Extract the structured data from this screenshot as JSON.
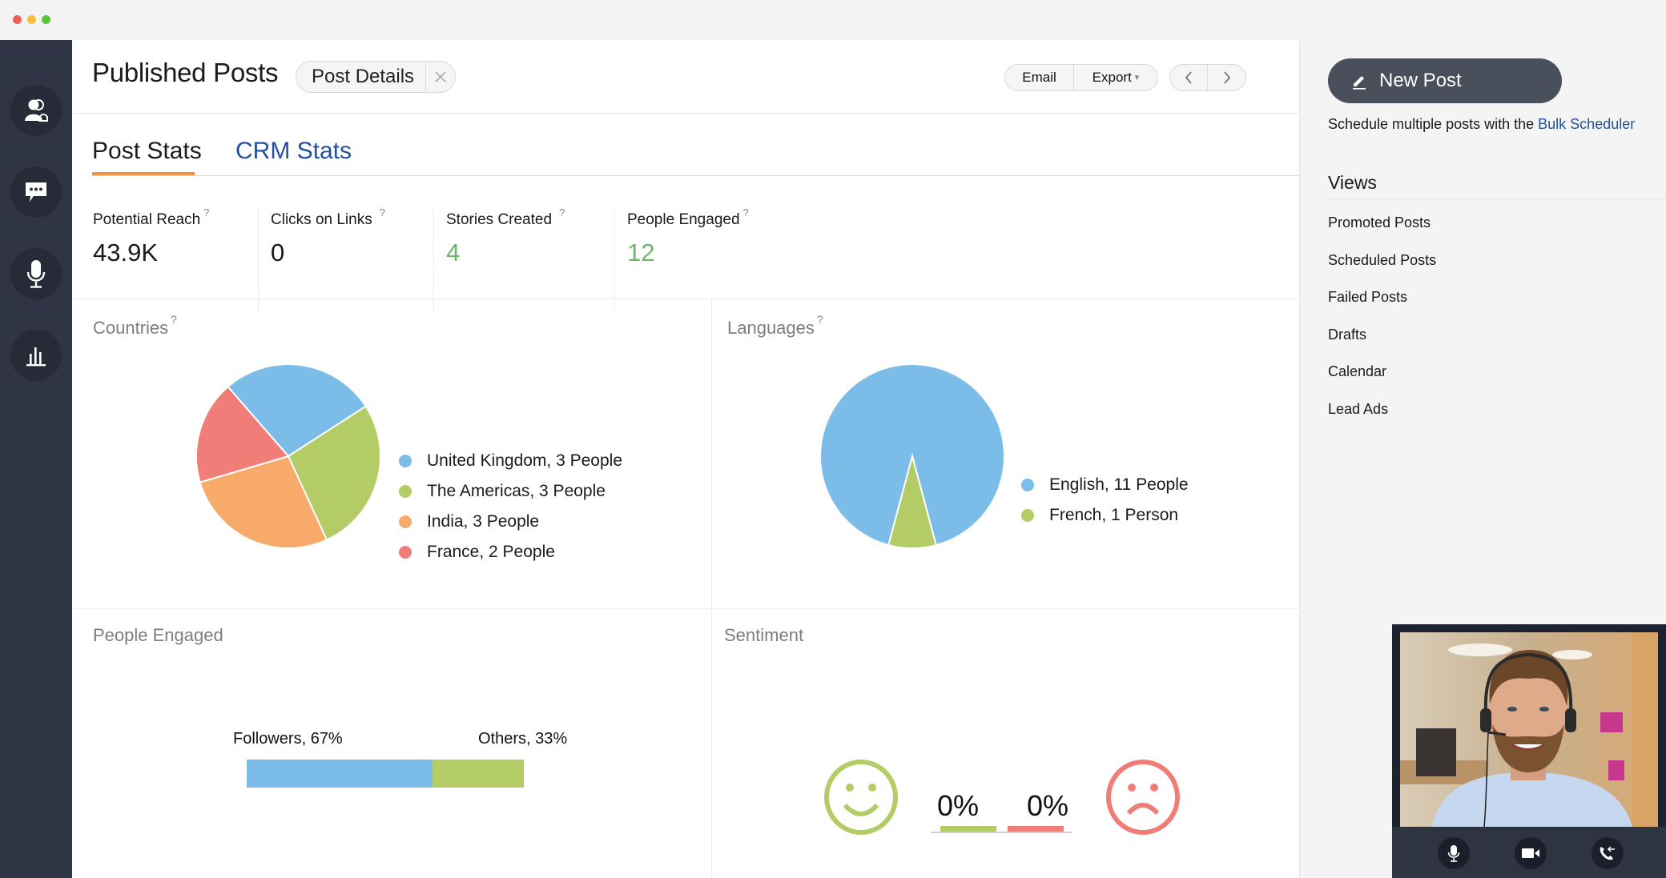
{
  "window": {
    "traffic_lights": {
      "close": "#ee5f57",
      "minimize": "#f5be3e",
      "maximize": "#5fc23f"
    }
  },
  "sidebar": {
    "items": [
      {
        "name": "contacts",
        "icon": "people-icon"
      },
      {
        "name": "messages",
        "icon": "chat-bubble-icon"
      },
      {
        "name": "voice",
        "icon": "microphone-icon"
      },
      {
        "name": "reports",
        "icon": "bar-chart-icon"
      }
    ]
  },
  "header": {
    "title": "Published Posts",
    "chip_label": "Post Details",
    "chip_close": "✕",
    "email_label": "Email",
    "export_label": "Export",
    "export_caret": "▾",
    "prev_label": "‹",
    "next_label": "›"
  },
  "tabs": [
    {
      "label": "Post Stats",
      "active": true
    },
    {
      "label": "CRM Stats",
      "active": false
    }
  ],
  "stats": [
    {
      "label": "Potential Reach",
      "help": "?",
      "value": "43.9K",
      "color": "#1b1b1b"
    },
    {
      "label": "Clicks on Links",
      "help": "?",
      "value": "0",
      "color": "#1b1b1b"
    },
    {
      "label": "Stories Created",
      "help": "?",
      "value": "4",
      "color": "#6fb46a"
    },
    {
      "label": "People Engaged",
      "help": "?",
      "value": "12",
      "color": "#6fb46a"
    }
  ],
  "panels": {
    "countries": {
      "title": "Countries",
      "help": "?"
    },
    "languages": {
      "title": "Languages",
      "help": "?"
    },
    "people_engaged": {
      "title": "People Engaged"
    },
    "sentiment": {
      "title": "Sentiment"
    }
  },
  "chart_data": [
    {
      "type": "pie",
      "title": "Countries",
      "categories": [
        "United Kingdom",
        "The Americas",
        "India",
        "France"
      ],
      "values": [
        3,
        3,
        3,
        2
      ],
      "unit": "People",
      "colors": [
        "#7bbde8",
        "#b3cc65",
        "#f8aa6a",
        "#f17d78"
      ],
      "legend_labels": [
        "United Kingdom, 3 People",
        "The Americas, 3 People",
        "India, 3 People",
        "France, 2 People"
      ],
      "legend": "right"
    },
    {
      "type": "pie",
      "title": "Languages",
      "categories": [
        "English",
        "French"
      ],
      "values": [
        11,
        1
      ],
      "colors": [
        "#7bbde8",
        "#b3cc65"
      ],
      "legend_labels": [
        "English, 11 People",
        "French, 1 Person"
      ],
      "legend": "right"
    },
    {
      "type": "bar",
      "title": "People Engaged",
      "orientation": "horizontal-stacked",
      "categories": [
        "Followers",
        "Others"
      ],
      "values": [
        67,
        33
      ],
      "unit": "%",
      "colors": [
        "#7bbde8",
        "#b3cc65"
      ],
      "labels": [
        "Followers, 67%",
        "Others, 33%"
      ]
    },
    {
      "type": "bar",
      "title": "Sentiment",
      "categories": [
        "Positive",
        "Negative"
      ],
      "values": [
        0,
        0
      ],
      "unit": "%",
      "colors": [
        "#b3cc65",
        "#f17d78"
      ],
      "labels": [
        "0%",
        "0%"
      ]
    }
  ],
  "right_panel": {
    "new_post_label": "New Post",
    "schedule_text": "Schedule multiple posts with the ",
    "bulk_scheduler_link": "Bulk Scheduler",
    "views_title": "Views",
    "views": [
      "Promoted Posts",
      "Scheduled Posts",
      "Failed Posts",
      "Drafts",
      "Calendar",
      "Lead Ads"
    ]
  },
  "video_call": {
    "controls": [
      {
        "name": "mute",
        "icon": "microphone-icon"
      },
      {
        "name": "video",
        "icon": "video-camera-icon"
      },
      {
        "name": "call",
        "icon": "phone-transfer-icon"
      }
    ]
  }
}
